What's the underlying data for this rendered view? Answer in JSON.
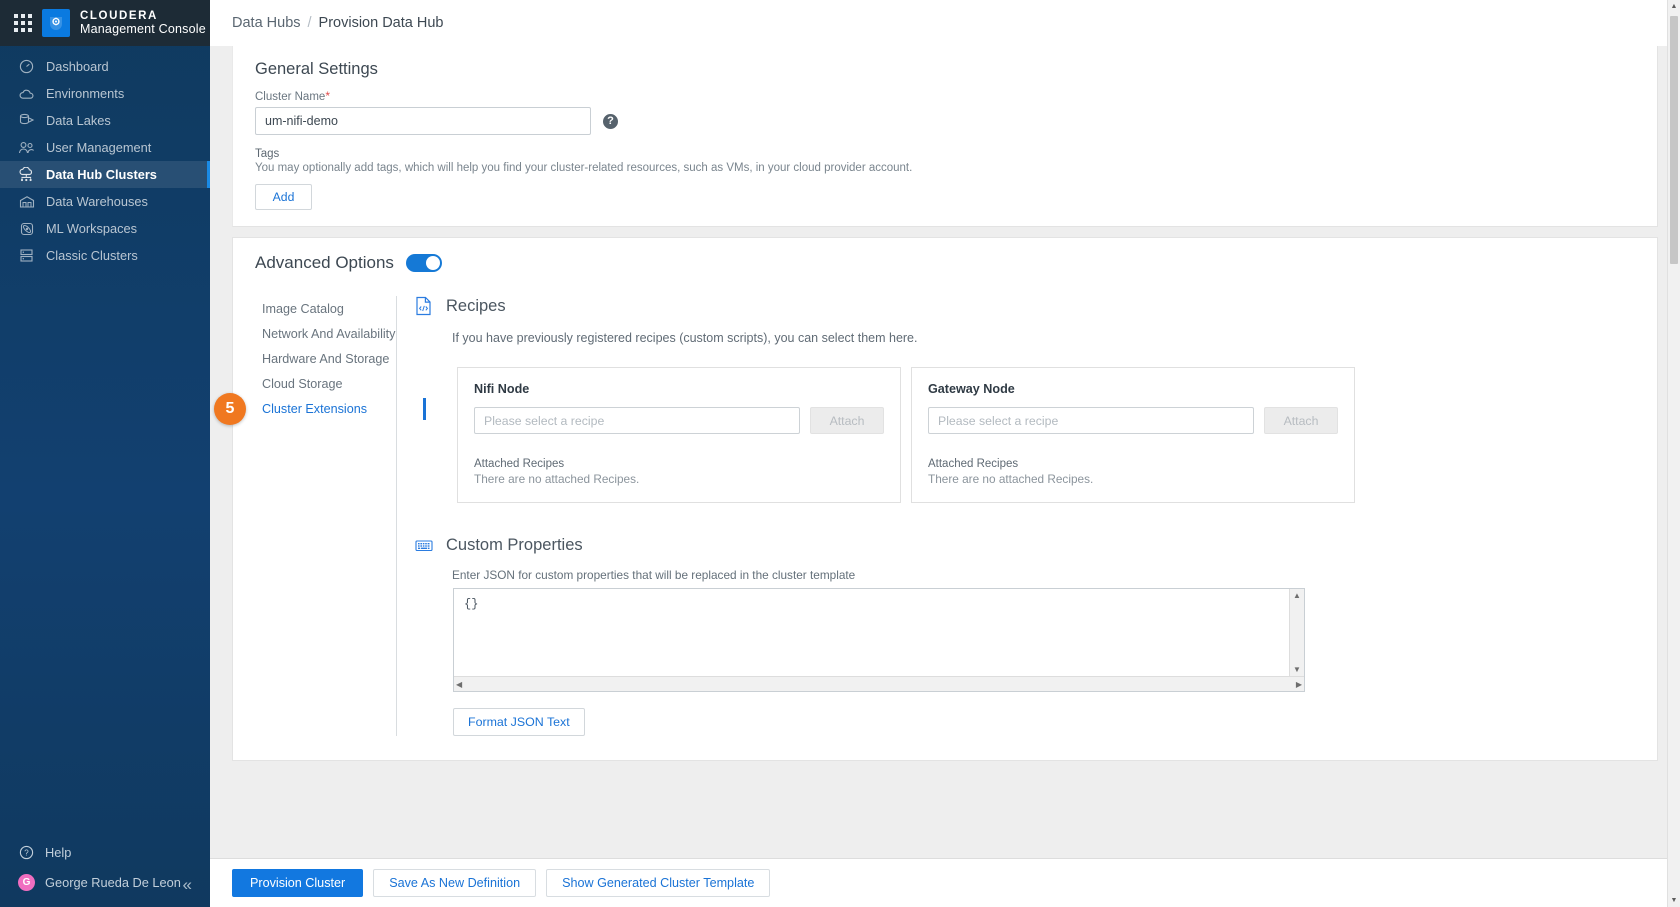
{
  "sidebar": {
    "brand": {
      "top": "CLOUDERA",
      "sub": "Management Console",
      "waffle_icon": "apps-grid-icon",
      "logo_icon": "cloudera-logo-icon"
    },
    "items": [
      {
        "label": "Dashboard",
        "icon": "gauge-icon",
        "active": false
      },
      {
        "label": "Environments",
        "icon": "cloud-icon",
        "active": false
      },
      {
        "label": "Data Lakes",
        "icon": "data-lake-icon",
        "active": false
      },
      {
        "label": "User Management",
        "icon": "users-icon",
        "active": false
      },
      {
        "label": "Data Hub Clusters",
        "icon": "cluster-cloud-icon",
        "active": true
      },
      {
        "label": "Data Warehouses",
        "icon": "warehouse-icon",
        "active": false
      },
      {
        "label": "ML Workspaces",
        "icon": "ml-atom-icon",
        "active": false
      },
      {
        "label": "Classic Clusters",
        "icon": "server-rack-icon",
        "active": false
      }
    ],
    "help": {
      "label": "Help",
      "icon": "question-circle-icon"
    },
    "user": {
      "label": "George Rueda De Leon",
      "initial": "G",
      "avatar_color": "#f06ec0"
    },
    "collapse": {
      "icon": "double-chevron-left-icon",
      "glyph": "«"
    }
  },
  "breadcrumb": {
    "root": "Data Hubs",
    "separator": "/",
    "current": "Provision Data Hub"
  },
  "general_settings": {
    "title": "General Settings",
    "cluster_name": {
      "label": "Cluster Name",
      "required_mark": "*",
      "value": "um-nifi-demo",
      "help_icon": "question-circle-icon",
      "help_glyph": "?"
    },
    "tags": {
      "title": "Tags",
      "description": "You may optionally add tags, which will help you find your cluster-related resources, such as VMs, in your cloud provider account.",
      "add_label": "Add"
    }
  },
  "advanced_options": {
    "title": "Advanced Options",
    "toggle_on": true,
    "toggle_color": "#1579d6",
    "tabs": [
      {
        "label": "Image Catalog",
        "active": false
      },
      {
        "label": "Network And Availability",
        "active": false
      },
      {
        "label": "Hardware And Storage",
        "active": false
      },
      {
        "label": "Cloud Storage",
        "active": false
      },
      {
        "label": "Cluster Extensions",
        "active": true
      }
    ],
    "step_badge": {
      "value": "5",
      "color": "#f07820"
    }
  },
  "recipes": {
    "icon": "code-document-icon",
    "title": "Recipes",
    "description": "If you have previously registered recipes (custom scripts), you can select them here.",
    "nodes": [
      {
        "title": "Nifi Node",
        "select_placeholder": "Please select a recipe",
        "attach_label": "Attach",
        "attach_disabled": true,
        "attached_label": "Attached Recipes",
        "attached_empty": "There are no attached Recipes."
      },
      {
        "title": "Gateway Node",
        "select_placeholder": "Please select a recipe",
        "attach_label": "Attach",
        "attach_disabled": true,
        "attached_label": "Attached Recipes",
        "attached_empty": "There are no attached Recipes."
      }
    ]
  },
  "custom_properties": {
    "icon": "keyboard-icon",
    "title": "Custom Properties",
    "description": "Enter JSON for custom properties that will be replaced in the cluster template",
    "json_value": "{}",
    "format_button": "Format JSON Text",
    "scroll_up_glyph": "▲",
    "scroll_down_glyph": "▼",
    "scroll_left_glyph": "◀",
    "scroll_right_glyph": "▶"
  },
  "footer": {
    "provision": "Provision Cluster",
    "save_definition": "Save As New Definition",
    "show_template": "Show Generated Cluster Template"
  },
  "scrollbar": {
    "up_glyph": "▲",
    "down_glyph": "▼"
  }
}
